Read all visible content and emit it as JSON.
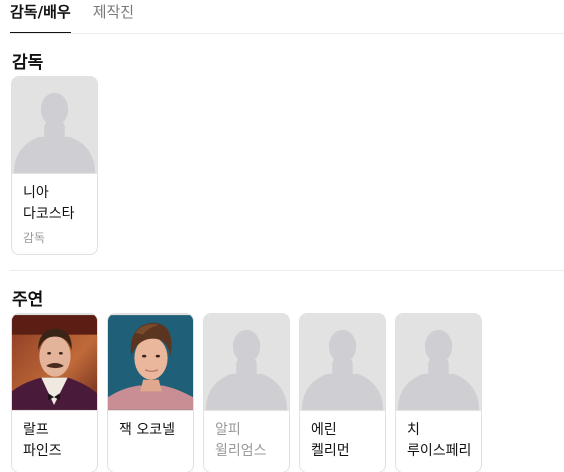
{
  "tabs": [
    {
      "label": "감독/배우",
      "active": true
    },
    {
      "label": "제작진",
      "active": false
    }
  ],
  "sections": {
    "director": {
      "title": "감독",
      "people": [
        {
          "name": "니아 다코스타",
          "role": "감독",
          "photo": "placeholder-silhouette"
        }
      ]
    },
    "cast": {
      "title": "주연",
      "people": [
        {
          "name": "랄프 파인즈",
          "photo": "portrait-photo"
        },
        {
          "name": "잭 오코넬",
          "photo": "portrait-photo"
        },
        {
          "name": "알피 윌리엄스",
          "photo": "placeholder-silhouette"
        },
        {
          "name": "에린 켈리먼",
          "photo": "placeholder-silhouette"
        },
        {
          "name": "치 루이스페리",
          "photo": "placeholder-silhouette"
        }
      ]
    }
  },
  "colors": {
    "placeholder_bg": "#e2e2e2",
    "placeholder_figure": "#cfcfd3",
    "divider": "#ececec",
    "muted_text": "#9a9a9a"
  }
}
